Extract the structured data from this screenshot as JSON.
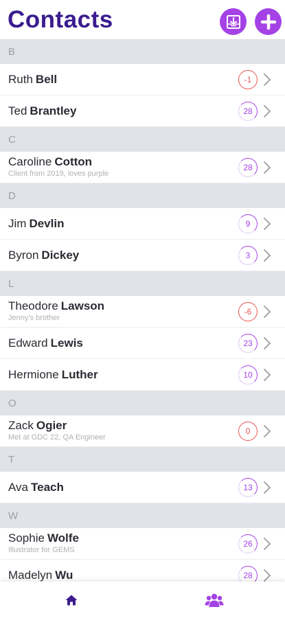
{
  "header": {
    "title": "Contacts"
  },
  "sections": [
    {
      "letter": "B",
      "contacts": [
        {
          "first": "Ruth",
          "last": "Bell",
          "note": "",
          "days": "-1",
          "status": "neg"
        },
        {
          "first": "Ted",
          "last": "Brantley",
          "note": "",
          "days": "28",
          "status": "pos"
        }
      ]
    },
    {
      "letter": "C",
      "contacts": [
        {
          "first": "Caroline",
          "last": "Cotton",
          "note": "Client from 2019, loves purple",
          "days": "28",
          "status": "pos"
        }
      ]
    },
    {
      "letter": "D",
      "contacts": [
        {
          "first": "Jim",
          "last": "Devlin",
          "note": "",
          "days": "9",
          "status": "pos"
        },
        {
          "first": "Byron",
          "last": "Dickey",
          "note": "",
          "days": "3",
          "status": "pos"
        }
      ]
    },
    {
      "letter": "L",
      "contacts": [
        {
          "first": "Theodore",
          "last": "Lawson",
          "note": "Jenny's brother",
          "days": "-6",
          "status": "neg"
        },
        {
          "first": "Edward",
          "last": "Lewis",
          "note": "",
          "days": "23",
          "status": "pos"
        },
        {
          "first": "Hermione",
          "last": "Luther",
          "note": "",
          "days": "10",
          "status": "pos"
        }
      ]
    },
    {
      "letter": "O",
      "contacts": [
        {
          "first": "Zack",
          "last": "Ogier",
          "note": "Met at GDC 22, QA Engineer",
          "days": "0",
          "status": "neg"
        }
      ]
    },
    {
      "letter": "T",
      "contacts": [
        {
          "first": "Ava",
          "last": "Teach",
          "note": "",
          "days": "13",
          "status": "pos"
        }
      ]
    },
    {
      "letter": "W",
      "contacts": [
        {
          "first": "Sophie",
          "last": "Wolfe",
          "note": "Illustrator for GEMS",
          "days": "26",
          "status": "pos"
        },
        {
          "first": "Madelyn",
          "last": "Wu",
          "note": "",
          "days": "28",
          "status": "pos"
        }
      ]
    }
  ],
  "icons": {
    "import": "download-tray-icon",
    "add": "plus-icon",
    "home": "home-icon",
    "contacts": "people-group-icon",
    "chevron": "chevron-right-icon"
  },
  "colors": {
    "title": "#3b1c8f",
    "accent": "#a542e6",
    "overdue": "#e85454",
    "section_bg": "#e1e3e8"
  }
}
